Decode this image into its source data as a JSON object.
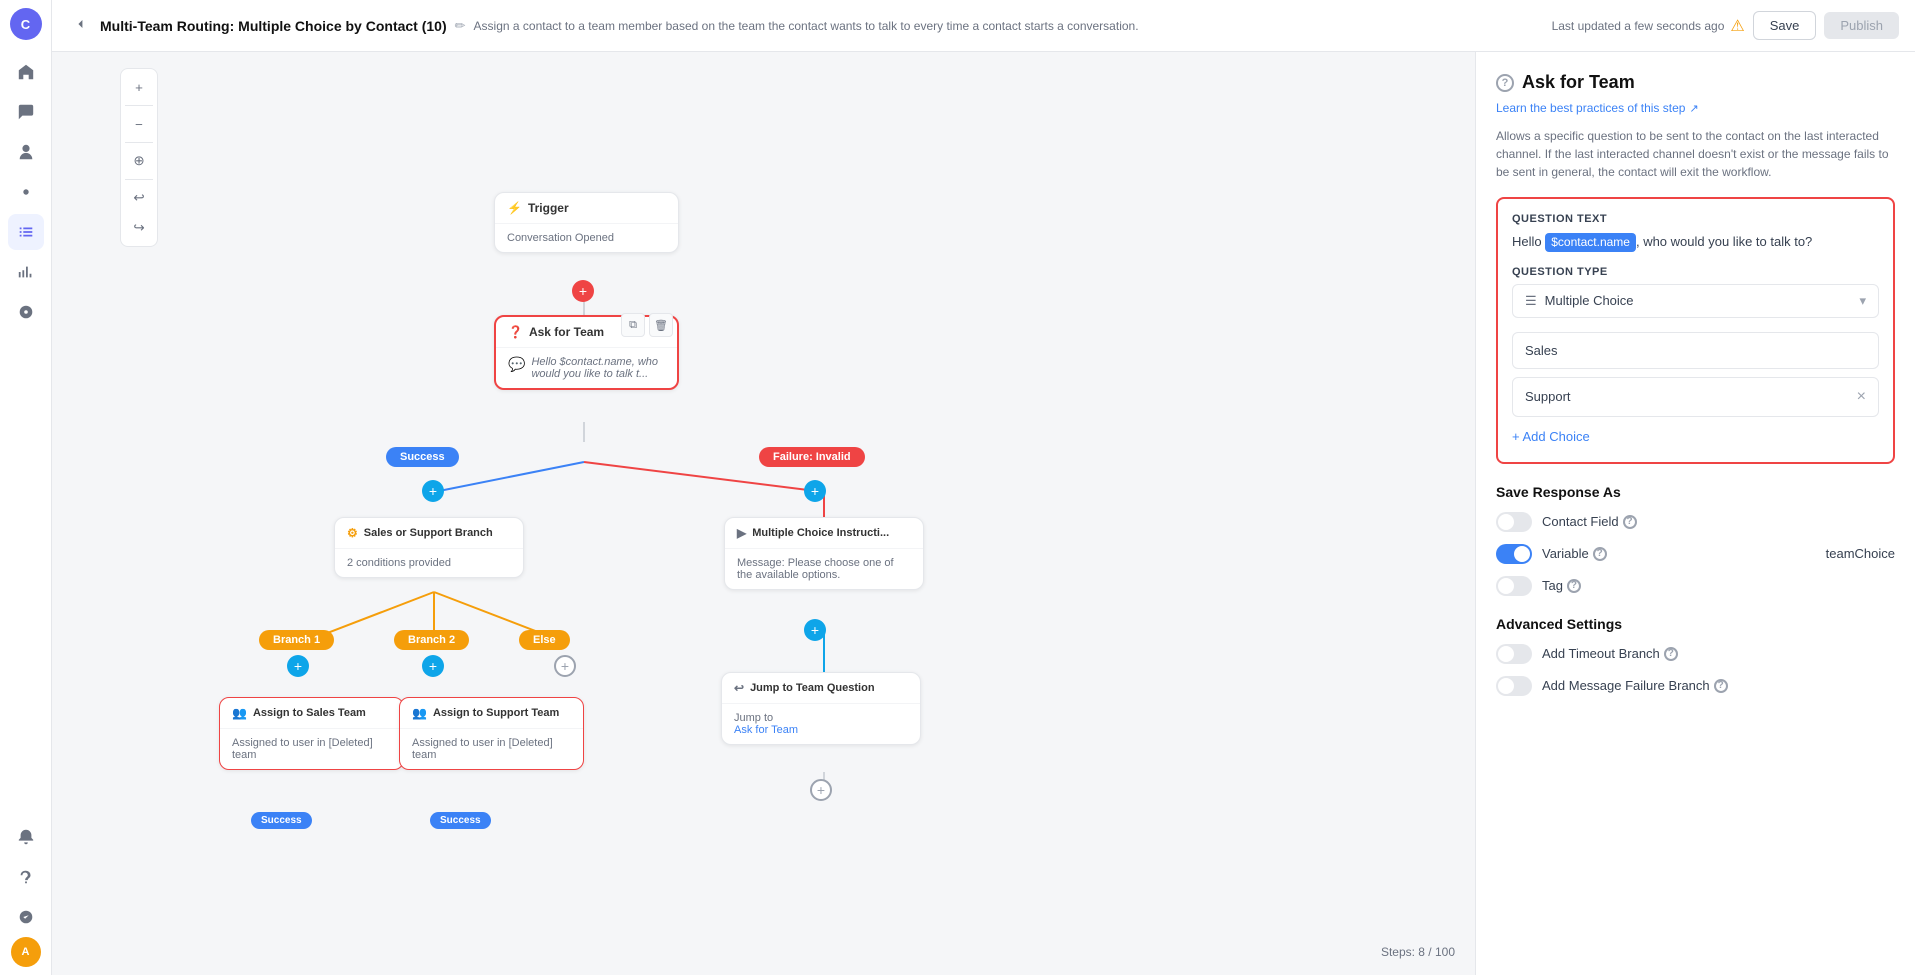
{
  "header": {
    "back_label": "←",
    "title": "Multi-Team Routing: Multiple Choice by Contact (10)",
    "description": "Assign a contact to a team member based on the team the contact wants to talk to every time a contact starts a conversation.",
    "status": "Last updated a few seconds ago",
    "save_label": "Save",
    "publish_label": "Publish"
  },
  "nav": {
    "avatar": "C",
    "user_initials": "A"
  },
  "canvas": {
    "zoom_in": "+",
    "zoom_out": "−",
    "fit": "⊹",
    "undo": "↩",
    "redo": "↪"
  },
  "nodes": {
    "trigger": {
      "label": "Trigger",
      "body": "Conversation Opened"
    },
    "ask_for_team": {
      "label": "Ask for Team",
      "body": "Hello $contact.name, who would you like to talk t..."
    },
    "sales_support_branch": {
      "label": "Sales or Support Branch",
      "body": "2 conditions provided"
    },
    "multiple_choice_instruction": {
      "label": "Multiple Choice Instructi...",
      "body": "Message: Please choose one of the available options."
    },
    "assign_sales": {
      "label": "Assign to Sales Team",
      "body": "Assigned to user in [Deleted] team"
    },
    "assign_support": {
      "label": "Assign to Support Team",
      "body": "Assigned to user in [Deleted] team"
    },
    "jump_team_question": {
      "label": "Jump to Team Question",
      "jump_to_label": "Jump to",
      "jump_to_link": "Ask for Team"
    }
  },
  "tags": {
    "success": "Success",
    "failure": "Failure: Invalid",
    "branch1": "Branch 1",
    "branch2": "Branch 2",
    "else": "Else"
  },
  "right_panel": {
    "title": "Ask for Team",
    "help_link": "Learn the best practices of this step",
    "description": "Allows a specific question to be sent to the contact on the last interacted channel. If the last interacted channel doesn't exist or the message fails to be sent in general, the contact will exit the workflow.",
    "question_text_label": "Question Text",
    "question_text_prefix": "Hello ",
    "contact_name_chip": "$contact.name",
    "question_text_suffix": ", who would you like to talk to?",
    "question_type_label": "Question Type",
    "question_type_value": "Multiple Choice",
    "choices": [
      {
        "label": "Sales"
      },
      {
        "label": "Support"
      }
    ],
    "add_choice_label": "+ Add Choice",
    "save_response_label": "Save Response As",
    "toggles": [
      {
        "key": "contact_field",
        "label": "Contact Field",
        "on": false
      },
      {
        "key": "variable",
        "label": "Variable",
        "on": true,
        "value": "teamChoice"
      },
      {
        "key": "tag",
        "label": "Tag",
        "on": false
      }
    ],
    "advanced_settings_label": "Advanced Settings",
    "advanced_toggles": [
      {
        "key": "add_timeout",
        "label": "Add Timeout Branch"
      },
      {
        "key": "add_message_failure",
        "label": "Add Message Failure Branch"
      }
    ]
  },
  "footer": {
    "steps": "Steps: 8 / 100"
  }
}
